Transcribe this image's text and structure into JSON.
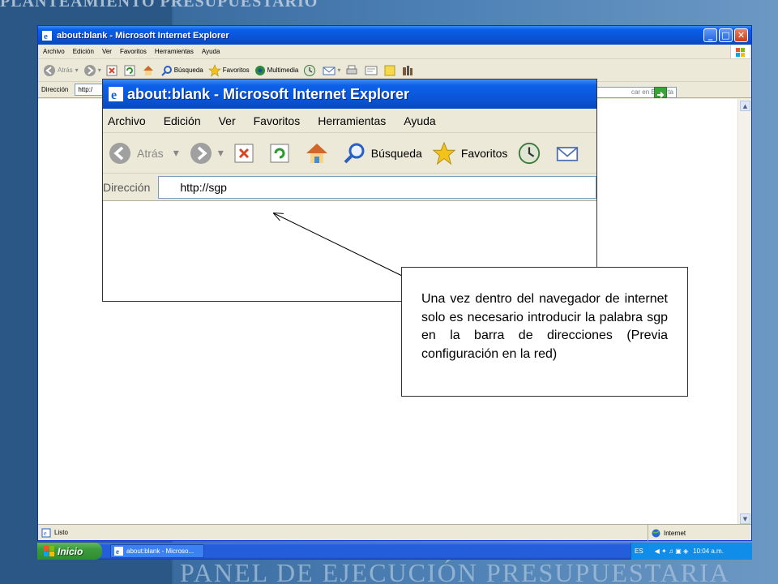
{
  "background": {
    "top_text": "PLANTEAMIENTO PRESUPUESTARIO",
    "bottom_text": "PANEL DE EJECUCIÓN PRESUPUESTARIA"
  },
  "browser": {
    "title": "about:blank - Microsoft Internet Explorer",
    "window_buttons": {
      "minimize": "_",
      "maximize": "□",
      "close": "✕"
    },
    "menu": [
      "Archivo",
      "Edición",
      "Ver",
      "Favoritos",
      "Herramientas",
      "Ayuda"
    ],
    "toolbar": {
      "back": "Atrás",
      "search": "Búsqueda",
      "favorites": "Favoritos",
      "multimedia": "Multimedia"
    },
    "address_label": "Dirección",
    "address_value": "http:/",
    "encarta_text": "car en Encarta",
    "status": "Listo",
    "zone": "Internet"
  },
  "taskbar": {
    "start": "Inicio",
    "task": "about:blank - Microso...",
    "lang": "ES",
    "clock": "10:04 a.m."
  },
  "zoom": {
    "title": "about:blank - Microsoft Internet Explorer",
    "menu": [
      "Archivo",
      "Edición",
      "Ver",
      "Favoritos",
      "Herramientas",
      "Ayuda"
    ],
    "toolbar": {
      "back": "Atrás",
      "search": "Búsqueda",
      "favorites": "Favoritos"
    },
    "address_label": "Dirección",
    "address_value": "http://sgp"
  },
  "callout": {
    "text": "Una vez dentro del navegador de internet solo es necesario introducir la palabra sgp en la barra de direcciones (Previa configuración en la red)"
  },
  "colors": {
    "xp_blue": "#0a54d6",
    "start_green": "#3c9b3c",
    "window_face": "#ece9d8"
  }
}
